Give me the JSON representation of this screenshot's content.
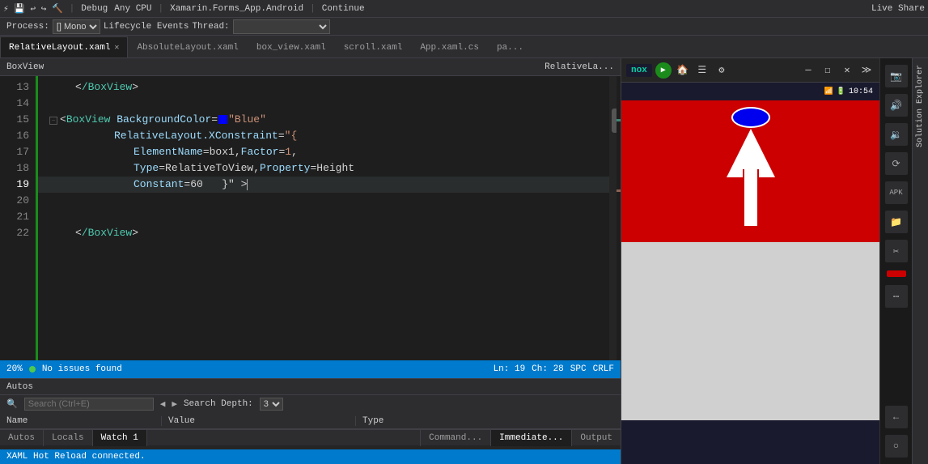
{
  "topbar": {
    "process_label": "Process:",
    "process_value": "[] Mono",
    "lifecycle_label": "Lifecycle Events",
    "thread_label": "Thread:",
    "debug_mode": "Debug",
    "cpu": "Any CPU",
    "app": "Xamarin.Forms_App.Android",
    "continue_label": "Continue",
    "live_share": "Live Share"
  },
  "tabs": [
    {
      "label": "RelativeLayout.xaml",
      "active": true,
      "closeable": true
    },
    {
      "label": "AbsoluteLayout.xaml",
      "active": false,
      "closeable": false
    },
    {
      "label": "box_view.xaml",
      "active": false,
      "closeable": false
    },
    {
      "label": "scroll.xaml",
      "active": false,
      "closeable": false
    },
    {
      "label": "App.xaml.cs",
      "active": false,
      "closeable": false
    },
    {
      "label": "pa...",
      "active": false,
      "closeable": false
    }
  ],
  "editor": {
    "breadcrumb": "BoxView",
    "breadcrumb_right": "RelativeLa...",
    "lines": [
      {
        "num": 13,
        "indent": 2,
        "content_html": "&lt;/BoxView&gt;"
      },
      {
        "num": 14,
        "indent": 0,
        "content_html": ""
      },
      {
        "num": 15,
        "indent": 1,
        "has_collapse": true,
        "content_html": "&lt;<span class='tag'>BoxView</span> <span class='attr'>BackgroundColor</span>=<span class='blue-box-inline'></span><span class='str'>\"Blue\"</span>"
      },
      {
        "num": 16,
        "indent": 4,
        "content_html": "<span class='attr'>RelativeLayout.XConstraint</span>=<span class='str'>\"{</span>"
      },
      {
        "num": 17,
        "indent": 5,
        "content_html": "<span class='attr'>ElementName</span>=box1,<span class='attr'>Factor</span>=<span class='str'>1</span>,"
      },
      {
        "num": 18,
        "indent": 5,
        "content_html": "<span class='attr'>Type</span>=RelativeToView,<span class='attr'>Property</span>=Height"
      },
      {
        "num": 19,
        "indent": 5,
        "content_html": "<span class='attr'>Constant</span>=60&nbsp;&nbsp;&nbsp;}\" &gt;"
      },
      {
        "num": 20,
        "indent": 0,
        "content_html": ""
      },
      {
        "num": 21,
        "indent": 0,
        "content_html": ""
      },
      {
        "num": 22,
        "indent": 2,
        "content_html": "&lt;/BoxView&gt;"
      }
    ]
  },
  "status_bar": {
    "zoom": "20%",
    "no_issues": "No issues found",
    "ln": "Ln: 19",
    "ch": "Ch: 28",
    "spc": "SPC",
    "crlf": "CRLF"
  },
  "autos_panel": {
    "title": "Autos",
    "tabs": [
      "Autos",
      "Locals",
      "Watch 1"
    ],
    "active_tab": "Autos",
    "search_placeholder": "Search (Ctrl+E)",
    "search_depth_label": "Search Depth:",
    "columns": [
      "Name",
      "Value",
      "Type"
    ]
  },
  "bottom_tabs": {
    "tabs": [
      "Autos",
      "Locals",
      "Watch 1"
    ],
    "active": "Autos"
  },
  "emulator": {
    "logo": "nox",
    "time": "10:54",
    "status_bar_color": "#1a1a2e"
  },
  "bottom_tools": {
    "command_window": "Command...",
    "immediate_window": "Immediate...",
    "output": "Output"
  },
  "solution_explorer": {
    "label": "Solution Explorer"
  },
  "hotreload": {
    "text": "XAML Hot Reload connected."
  }
}
